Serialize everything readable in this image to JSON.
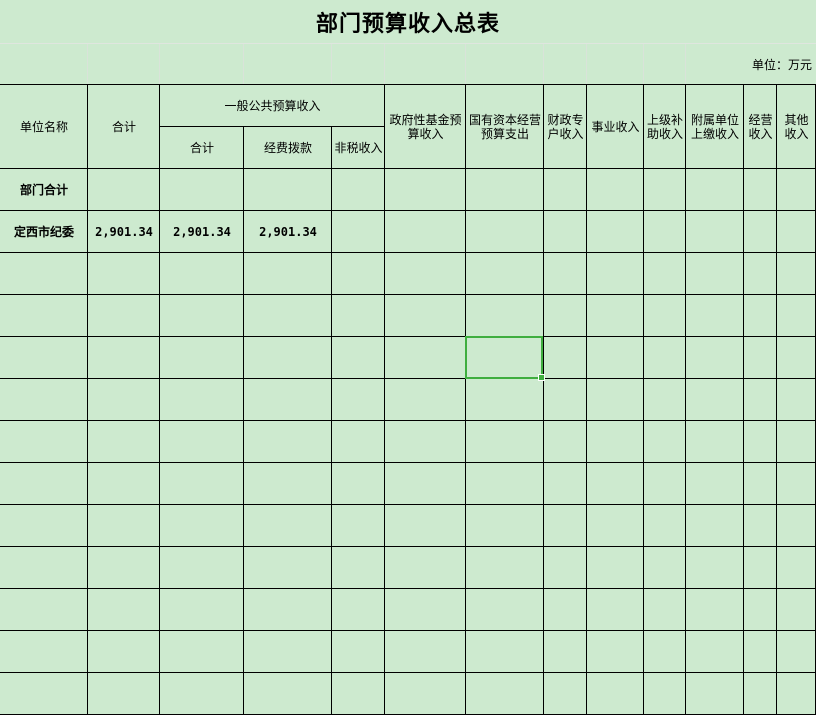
{
  "title": "部门预算收入总表",
  "unit_label": "单位：万元",
  "headers": {
    "unit_name": "单位名称",
    "total": "合计",
    "general_budget": "一般公共预算收入",
    "general_total": "合计",
    "general_funding": "经费拨款",
    "general_nontax": "非税收入",
    "gov_fund": "政府性基金预算收入",
    "state_capital": "国有资本经营预算支出",
    "fiscal_special": "财政专户收入",
    "business": "事业收入",
    "superior_subsidy": "上级补助收入",
    "affiliated": "附属单位上缴收入",
    "operating": "经营收入",
    "other": "其他收入"
  },
  "rows": [
    {
      "name": "部门合计",
      "total": "",
      "g_total": "",
      "g_funding": ""
    },
    {
      "name": "定西市纪委",
      "total": "2,901.34",
      "g_total": "2,901.34",
      "g_funding": "2,901.34"
    }
  ],
  "colors": {
    "background": "#cdeacf",
    "border": "#000000",
    "selection": "#3fae3f"
  }
}
